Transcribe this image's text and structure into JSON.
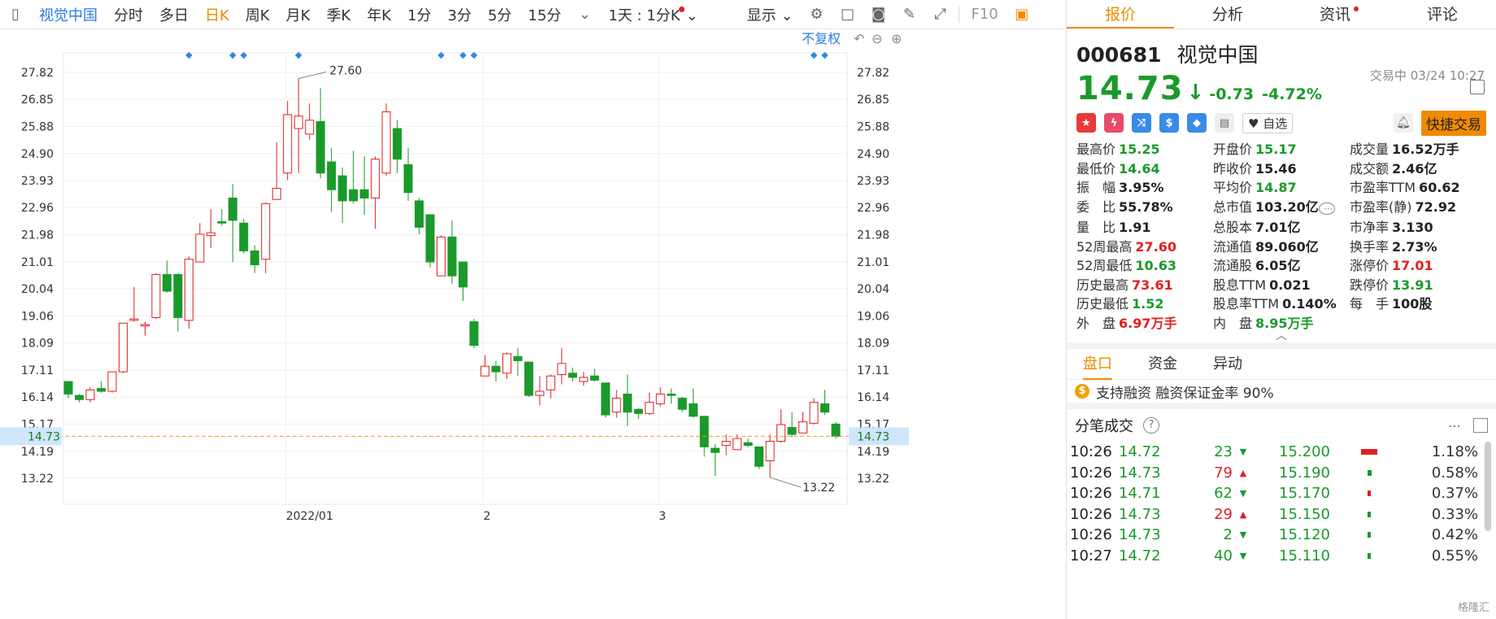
{
  "toolbar": {
    "stock_name": "视觉中国",
    "periods": [
      "分时",
      "多日",
      "日K",
      "周K",
      "月K",
      "季K",
      "年K",
      "1分",
      "3分",
      "5分",
      "15分"
    ],
    "active_period": "日K",
    "interval_label": "1天 : 1分K",
    "display_label": "显示",
    "f10_label": "F10"
  },
  "chart": {
    "no_adjust_label": "不复权",
    "price_labels": [
      "27.82",
      "26.85",
      "25.88",
      "24.90",
      "23.93",
      "22.96",
      "21.98",
      "21.01",
      "20.04",
      "19.06",
      "18.09",
      "17.11",
      "16.14",
      "15.17",
      "14.19",
      "13.22"
    ],
    "current_price_label": "14.73",
    "x_labels": [
      "2022/01",
      "2",
      "3"
    ],
    "high_annotation": "27.60",
    "low_annotation": "13.22"
  },
  "chart_data": {
    "type": "candlestick",
    "ylim": [
      12.5,
      28.5
    ],
    "current_price": 14.73,
    "up_color": "#e02020",
    "down_color": "#1a9a2a",
    "candles": [
      {
        "o": 16.7,
        "c": 16.25,
        "h": 16.7,
        "l": 16.1
      },
      {
        "o": 16.2,
        "c": 16.05,
        "h": 16.25,
        "l": 15.95
      },
      {
        "o": 16.05,
        "c": 16.4,
        "h": 16.5,
        "l": 15.95
      },
      {
        "o": 16.45,
        "c": 16.35,
        "h": 16.7,
        "l": 16.3
      },
      {
        "o": 16.35,
        "c": 17.05,
        "h": 17.05,
        "l": 16.3
      },
      {
        "o": 17.05,
        "c": 18.8,
        "h": 18.8,
        "l": 17.0
      },
      {
        "o": 18.9,
        "c": 18.95,
        "h": 20.1,
        "l": 18.85
      },
      {
        "o": 18.7,
        "c": 18.75,
        "h": 18.85,
        "l": 18.35
      },
      {
        "o": 19.0,
        "c": 20.55,
        "h": 20.6,
        "l": 18.95
      },
      {
        "o": 20.55,
        "c": 19.95,
        "h": 21.05,
        "l": 19.9
      },
      {
        "o": 20.55,
        "c": 19.0,
        "h": 20.6,
        "l": 18.5
      },
      {
        "o": 18.9,
        "c": 21.1,
        "h": 21.2,
        "l": 18.6
      },
      {
        "o": 21.0,
        "c": 22.0,
        "h": 22.4,
        "l": 21.0
      },
      {
        "o": 21.95,
        "c": 22.05,
        "h": 22.9,
        "l": 21.5
      },
      {
        "o": 22.45,
        "c": 22.4,
        "h": 22.9,
        "l": 22.3
      },
      {
        "o": 23.3,
        "c": 22.5,
        "h": 23.8,
        "l": 21.0
      },
      {
        "o": 22.4,
        "c": 21.4,
        "h": 22.55,
        "l": 21.3
      },
      {
        "o": 21.4,
        "c": 20.9,
        "h": 21.6,
        "l": 20.6
      },
      {
        "o": 21.1,
        "c": 23.1,
        "h": 23.15,
        "l": 20.6
      },
      {
        "o": 23.25,
        "c": 23.65,
        "h": 25.3,
        "l": 23.25
      },
      {
        "o": 24.2,
        "c": 26.3,
        "h": 26.8,
        "l": 23.95
      },
      {
        "o": 25.8,
        "c": 26.25,
        "h": 27.6,
        "l": 24.2
      },
      {
        "o": 25.6,
        "c": 26.1,
        "h": 26.7,
        "l": 25.4
      },
      {
        "o": 26.05,
        "c": 24.2,
        "h": 27.25,
        "l": 24.0
      },
      {
        "o": 24.6,
        "c": 23.6,
        "h": 25.1,
        "l": 22.8
      },
      {
        "o": 24.1,
        "c": 23.2,
        "h": 24.4,
        "l": 22.4
      },
      {
        "o": 23.6,
        "c": 23.2,
        "h": 25.0,
        "l": 23.1
      },
      {
        "o": 23.6,
        "c": 23.3,
        "h": 24.8,
        "l": 22.7
      },
      {
        "o": 23.3,
        "c": 24.7,
        "h": 24.8,
        "l": 22.2
      },
      {
        "o": 24.2,
        "c": 26.4,
        "h": 26.7,
        "l": 24.1
      },
      {
        "o": 25.8,
        "c": 24.7,
        "h": 26.1,
        "l": 24.2
      },
      {
        "o": 24.5,
        "c": 23.5,
        "h": 25.1,
        "l": 23.2
      },
      {
        "o": 23.2,
        "c": 22.25,
        "h": 23.3,
        "l": 22.0
      },
      {
        "o": 22.7,
        "c": 21.0,
        "h": 22.7,
        "l": 20.8
      },
      {
        "o": 20.5,
        "c": 21.9,
        "h": 21.95,
        "l": 20.5
      },
      {
        "o": 21.9,
        "c": 20.5,
        "h": 22.5,
        "l": 20.2
      },
      {
        "o": 21.0,
        "c": 20.1,
        "h": 21.0,
        "l": 19.6
      },
      {
        "o": 18.85,
        "c": 18.0,
        "h": 18.95,
        "l": 17.9
      },
      {
        "o": 16.9,
        "c": 17.25,
        "h": 17.65,
        "l": 16.9
      },
      {
        "o": 17.25,
        "c": 17.05,
        "h": 17.45,
        "l": 16.7
      },
      {
        "o": 17.0,
        "c": 17.7,
        "h": 17.75,
        "l": 16.8
      },
      {
        "o": 17.6,
        "c": 17.45,
        "h": 17.9,
        "l": 16.9
      },
      {
        "o": 17.4,
        "c": 16.2,
        "h": 17.4,
        "l": 16.15
      },
      {
        "o": 16.2,
        "c": 16.35,
        "h": 16.9,
        "l": 15.85
      },
      {
        "o": 16.4,
        "c": 16.9,
        "h": 16.95,
        "l": 16.1
      },
      {
        "o": 16.95,
        "c": 17.35,
        "h": 17.9,
        "l": 16.6
      },
      {
        "o": 17.0,
        "c": 16.85,
        "h": 17.2,
        "l": 16.7
      },
      {
        "o": 16.7,
        "c": 16.85,
        "h": 17.05,
        "l": 16.55
      },
      {
        "o": 16.9,
        "c": 16.75,
        "h": 17.15,
        "l": 16.7
      },
      {
        "o": 16.65,
        "c": 15.5,
        "h": 16.65,
        "l": 15.4
      },
      {
        "o": 15.6,
        "c": 16.1,
        "h": 16.4,
        "l": 15.4
      },
      {
        "o": 16.25,
        "c": 15.6,
        "h": 16.95,
        "l": 15.1
      },
      {
        "o": 15.7,
        "c": 15.55,
        "h": 15.75,
        "l": 15.35
      },
      {
        "o": 15.55,
        "c": 15.95,
        "h": 16.3,
        "l": 15.5
      },
      {
        "o": 15.9,
        "c": 16.25,
        "h": 16.5,
        "l": 15.8
      },
      {
        "o": 16.25,
        "c": 16.2,
        "h": 16.45,
        "l": 15.9
      },
      {
        "o": 16.1,
        "c": 15.7,
        "h": 16.15,
        "l": 15.6
      },
      {
        "o": 15.9,
        "c": 15.45,
        "h": 16.45,
        "l": 15.4
      },
      {
        "o": 15.45,
        "c": 14.35,
        "h": 15.45,
        "l": 14.0
      },
      {
        "o": 14.3,
        "c": 14.15,
        "h": 14.45,
        "l": 13.3
      },
      {
        "o": 14.4,
        "c": 14.55,
        "h": 14.8,
        "l": 14.05
      },
      {
        "o": 14.25,
        "c": 14.65,
        "h": 14.8,
        "l": 14.25
      },
      {
        "o": 14.5,
        "c": 14.4,
        "h": 14.65,
        "l": 14.35
      },
      {
        "o": 14.35,
        "c": 13.65,
        "h": 14.35,
        "l": 13.55
      },
      {
        "o": 13.85,
        "c": 14.55,
        "h": 14.8,
        "l": 13.25
      },
      {
        "o": 14.55,
        "c": 15.15,
        "h": 15.7,
        "l": 14.5
      },
      {
        "o": 15.05,
        "c": 14.8,
        "h": 15.6,
        "l": 14.7
      },
      {
        "o": 14.85,
        "c": 15.25,
        "h": 15.6,
        "l": 14.85
      },
      {
        "o": 15.2,
        "c": 15.95,
        "h": 16.1,
        "l": 15.15
      },
      {
        "o": 15.9,
        "c": 15.6,
        "h": 16.4,
        "l": 15.5
      },
      {
        "o": 15.17,
        "c": 14.73,
        "h": 15.25,
        "l": 14.64
      }
    ],
    "event_markers_at": [
      11,
      15,
      16,
      21,
      34,
      36,
      37,
      68,
      69
    ],
    "x_label_at": [
      20,
      38,
      54
    ]
  },
  "quote": {
    "code": "000681",
    "name": "视觉中国",
    "price": "14.73",
    "change": "-0.73",
    "change_pct": "-4.72%",
    "status": "交易中 03/24 10:27",
    "watch_label": "自选",
    "fast_trade_label": "快捷交易",
    "rows": [
      [
        [
          "最高价",
          "15.25",
          "g"
        ],
        [
          "开盘价",
          "15.17",
          "g"
        ],
        [
          "成交量",
          "16.52万手",
          ""
        ]
      ],
      [
        [
          "最低价",
          "14.64",
          "g"
        ],
        [
          "昨收价",
          "15.46",
          ""
        ],
        [
          "成交额",
          "2.46亿",
          ""
        ]
      ],
      [
        [
          "振　幅",
          "3.95%",
          ""
        ],
        [
          "平均价",
          "14.87",
          "g"
        ],
        [
          "市盈率TTM",
          "60.62",
          ""
        ]
      ],
      [
        [
          "委　比",
          "55.78%",
          ""
        ],
        [
          "总市值",
          "103.20亿",
          ""
        ],
        [
          "市盈率(静)",
          "72.92",
          ""
        ]
      ],
      [
        [
          "量　比",
          "1.91",
          ""
        ],
        [
          "总股本",
          "7.01亿",
          ""
        ],
        [
          "市净率",
          "3.130",
          ""
        ]
      ],
      [
        [
          "52周最高",
          "27.60",
          "r"
        ],
        [
          "流通值",
          "89.060亿",
          ""
        ],
        [
          "换手率",
          "2.73%",
          ""
        ]
      ],
      [
        [
          "52周最低",
          "10.63",
          "g"
        ],
        [
          "流通股",
          "6.05亿",
          ""
        ],
        [
          "涨停价",
          "17.01",
          "r"
        ]
      ],
      [
        [
          "历史最高",
          "73.61",
          "r"
        ],
        [
          "股息TTM",
          "0.021",
          ""
        ],
        [
          "跌停价",
          "13.91",
          "g"
        ]
      ],
      [
        [
          "历史最低",
          "1.52",
          "g"
        ],
        [
          "股息率TTM",
          "0.140%",
          ""
        ],
        [
          "每　手",
          "100股",
          ""
        ]
      ],
      [
        [
          "外　盘",
          "6.97万手",
          "r"
        ],
        [
          "内　盘",
          "8.95万手",
          "g"
        ],
        [
          "",
          "",
          ""
        ]
      ]
    ]
  },
  "tabs": [
    "报价",
    "分析",
    "资讯",
    "评论"
  ],
  "subtabs": [
    "盘口",
    "资金",
    "异动"
  ],
  "margin": {
    "text": "支持融资 融资保证金率 90%",
    "icon_text": "$"
  },
  "ticks": {
    "title": "分笔成交",
    "rows": [
      [
        "10:26",
        "14.72",
        "23",
        "down",
        "15.200",
        "1.18%"
      ],
      [
        "10:26",
        "14.73",
        "79",
        "up",
        "15.190",
        "0.58%"
      ],
      [
        "10:26",
        "14.71",
        "62",
        "down",
        "15.170",
        "0.37%"
      ],
      [
        "10:26",
        "14.73",
        "29",
        "up",
        "15.150",
        "0.33%"
      ],
      [
        "10:26",
        "14.73",
        "2",
        "down",
        "15.120",
        "0.42%"
      ],
      [
        "10:27",
        "14.72",
        "40",
        "down",
        "15.110",
        "0.55%"
      ]
    ],
    "bars": [
      {
        "pct": 100,
        "up": true
      },
      {
        "pct": 25,
        "up": false
      },
      {
        "pct": 20,
        "up": true
      },
      {
        "pct": 16,
        "up": false
      },
      {
        "pct": 18,
        "up": false
      },
      {
        "pct": 24,
        "up": false
      }
    ]
  },
  "watermark": "格隆汇"
}
